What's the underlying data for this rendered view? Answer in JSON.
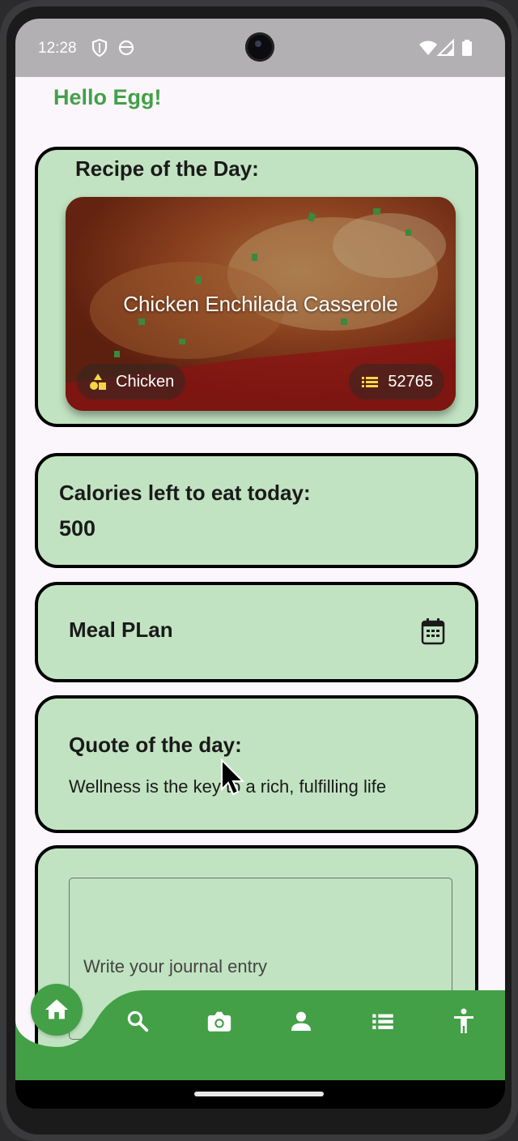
{
  "status_bar": {
    "time": "12:28"
  },
  "app": {
    "greeting": "Hello Egg!",
    "recipe_card": {
      "heading": "Recipe of the Day:",
      "recipe_title": "Chicken Enchilada Casserole",
      "category": "Chicken",
      "recipe_id": "52765"
    },
    "calories_card": {
      "heading": "Calories left to eat today:",
      "value": "500"
    },
    "meal_plan": {
      "label": "Meal PLan"
    },
    "quote_card": {
      "heading": "Quote of the day:",
      "quote": "Wellness is the key to a rich, fulfilling life"
    },
    "journal": {
      "placeholder": "Write your journal entry"
    }
  },
  "bottom_nav": {
    "items": [
      "home-icon",
      "search-icon",
      "camera-icon",
      "person-icon",
      "list-icon",
      "accessibility-icon"
    ],
    "active": "home-icon"
  },
  "colors": {
    "brand_green": "#43a047",
    "card_green": "#c1e3c1",
    "background": "#fbf6fc"
  }
}
